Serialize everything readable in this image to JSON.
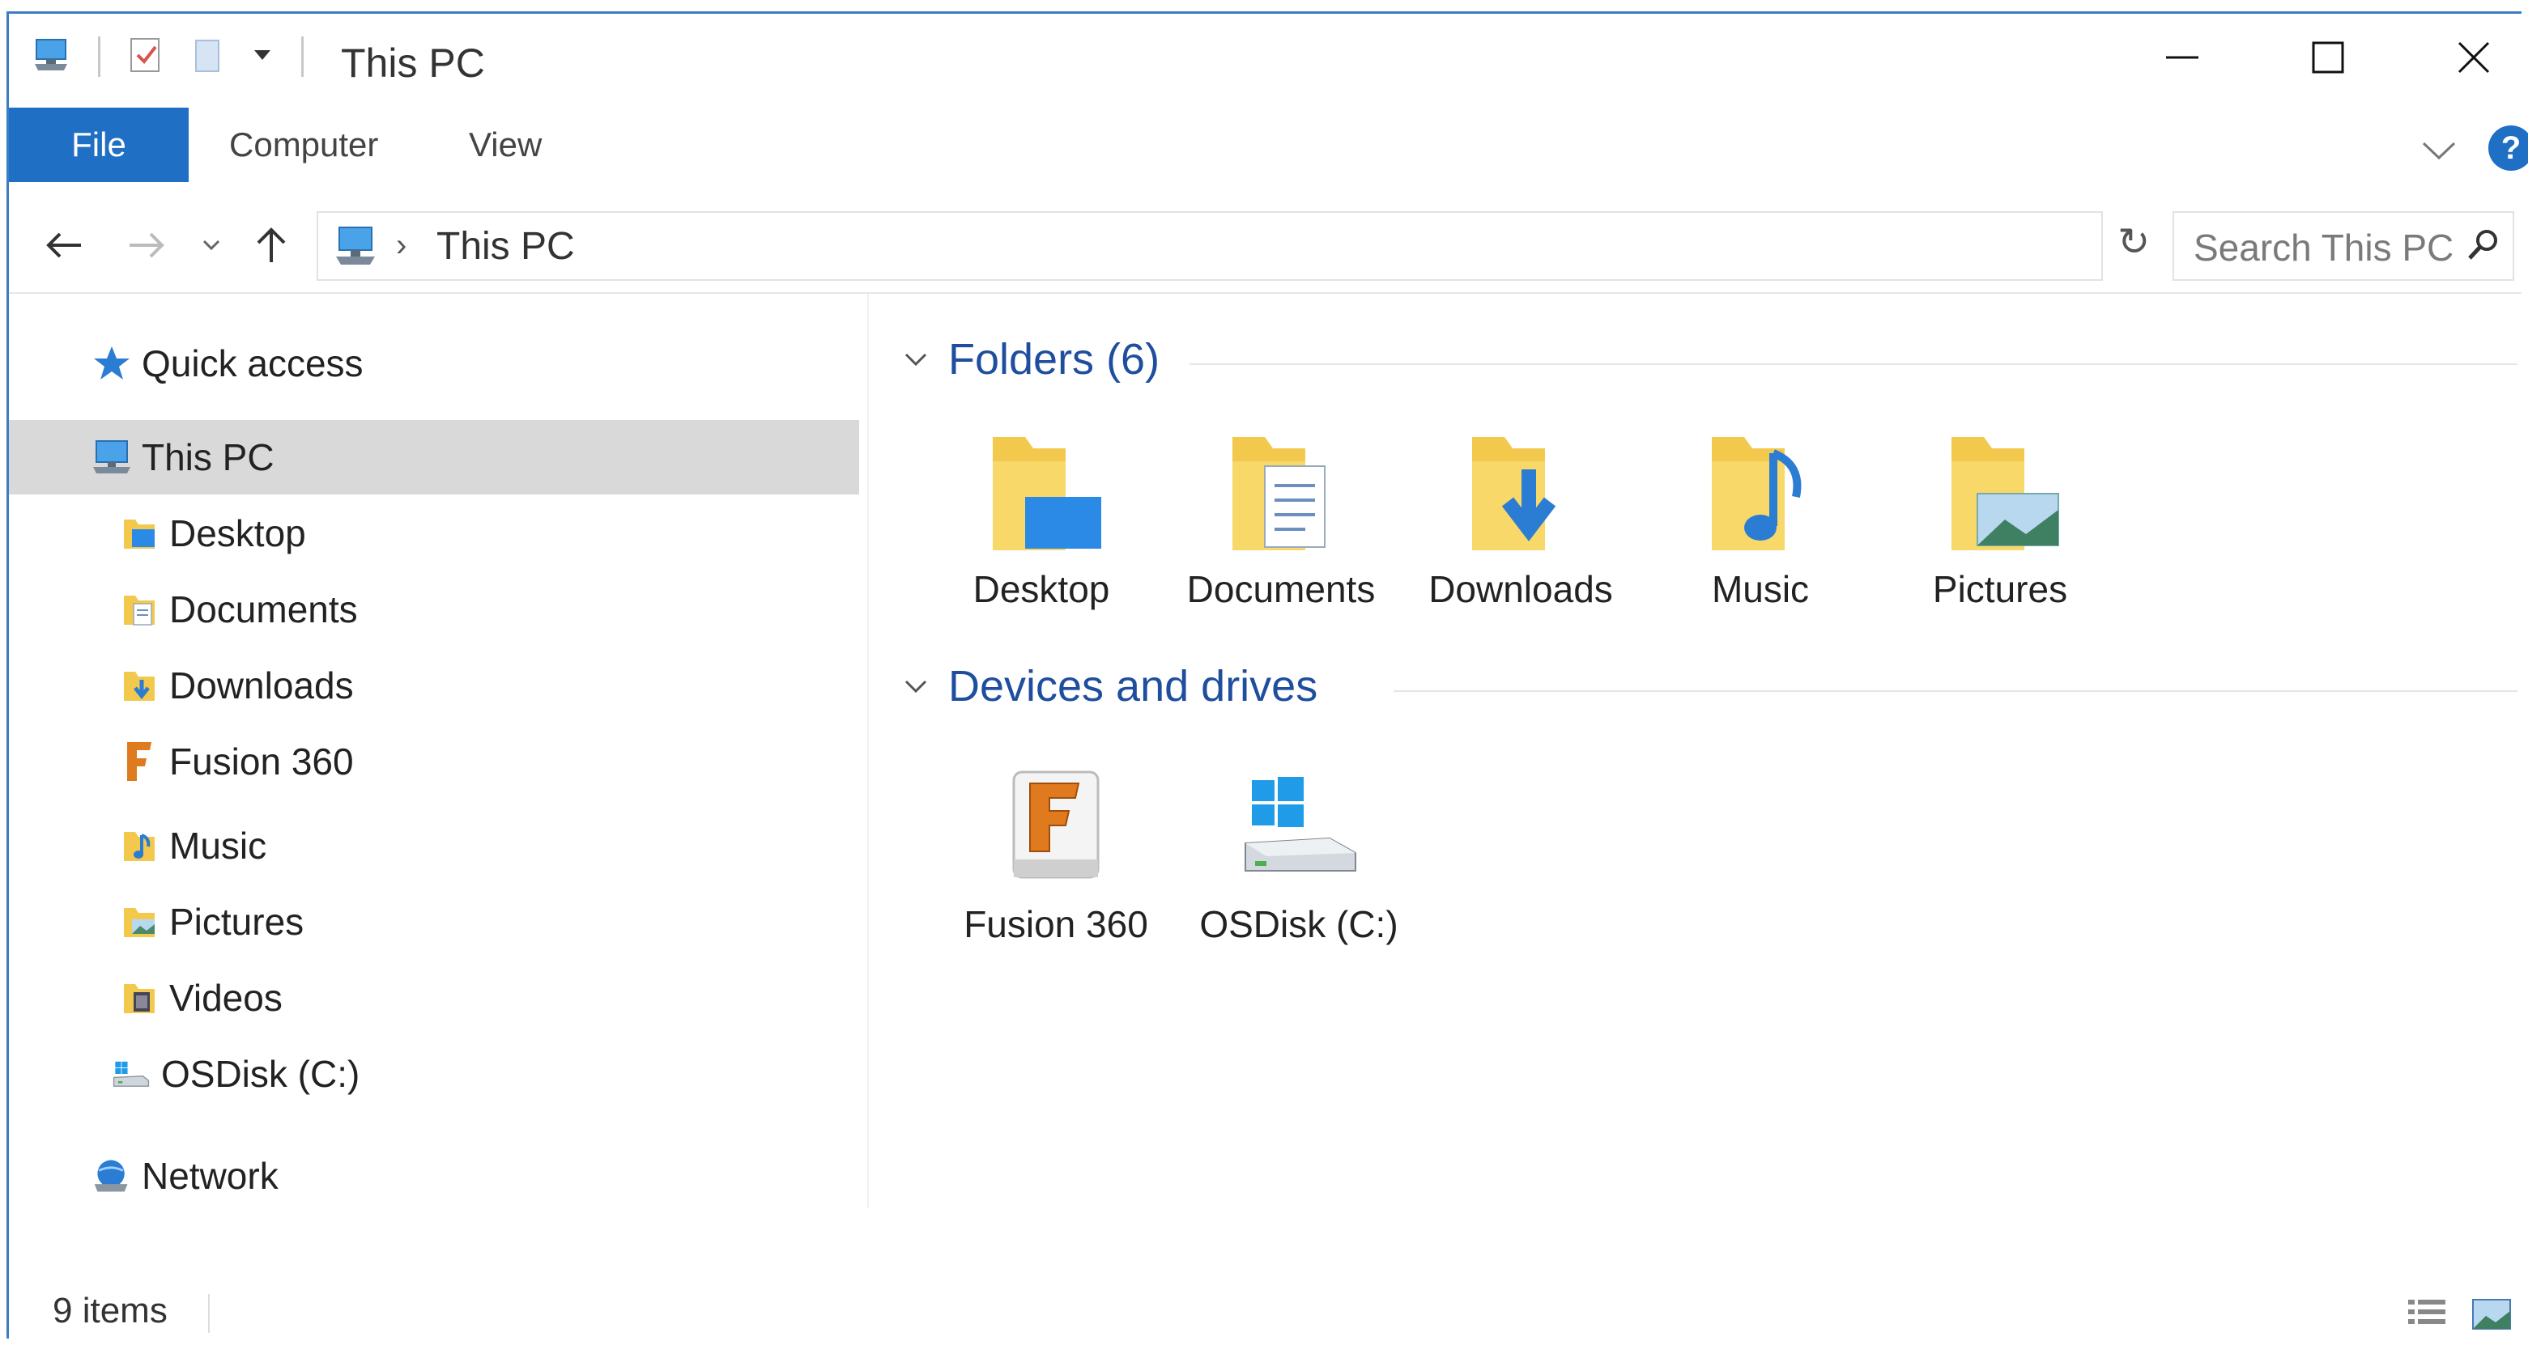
{
  "window": {
    "title": "This PC"
  },
  "ribbon": {
    "tabs": [
      {
        "label": "File",
        "active": true
      },
      {
        "label": "Computer"
      },
      {
        "label": "View"
      }
    ],
    "help_label": "?"
  },
  "address": {
    "path": "This PC",
    "search_placeholder": "Search This PC"
  },
  "nav": {
    "quick_access": "Quick access",
    "this_pc": "This PC",
    "items": [
      {
        "label": "Desktop",
        "icon": "desktop-folder-icon"
      },
      {
        "label": "Documents",
        "icon": "documents-folder-icon"
      },
      {
        "label": "Downloads",
        "icon": "downloads-folder-icon"
      },
      {
        "label": "Fusion 360",
        "icon": "fusion-360-icon"
      },
      {
        "label": "Music",
        "icon": "music-folder-icon"
      },
      {
        "label": "Pictures",
        "icon": "pictures-folder-icon"
      },
      {
        "label": "Videos",
        "icon": "videos-folder-icon"
      },
      {
        "label": "OSDisk (C:)",
        "icon": "drive-icon"
      }
    ],
    "network": "Network"
  },
  "content": {
    "folders_header": "Folders (6)",
    "folders": [
      {
        "label": "Desktop",
        "icon": "desktop-folder-icon"
      },
      {
        "label": "Documents",
        "icon": "documents-folder-icon"
      },
      {
        "label": "Downloads",
        "icon": "downloads-folder-icon"
      },
      {
        "label": "Music",
        "icon": "music-folder-icon"
      },
      {
        "label": "Pictures",
        "icon": "pictures-folder-icon"
      }
    ],
    "devices_header": "Devices and drives",
    "devices": [
      {
        "label": "Fusion 360",
        "icon": "fusion-360-drive-icon"
      },
      {
        "label": "OSDisk (C:)",
        "icon": "windows-drive-icon"
      }
    ]
  },
  "status": {
    "items_count": "9 items"
  },
  "colors": {
    "accent": "#1f6fc5",
    "folder": "#f2c94c",
    "heading": "#1f4e9e",
    "selected": "#d9d9d9"
  }
}
